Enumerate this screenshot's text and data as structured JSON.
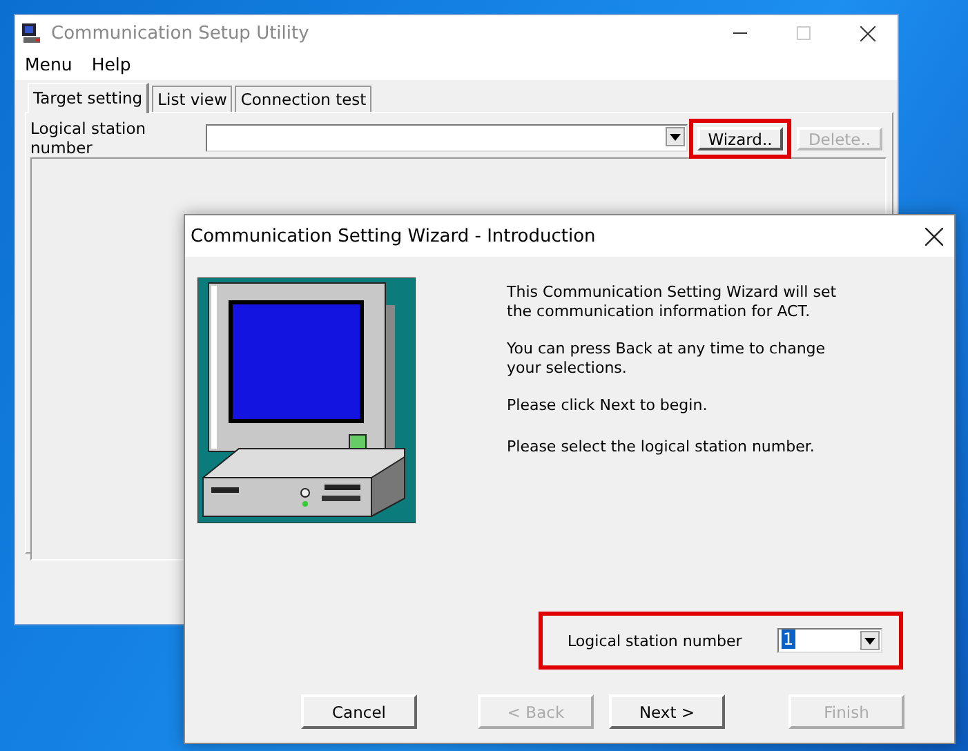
{
  "main_window": {
    "title": "Communication Setup Utility",
    "menu": [
      "Menu",
      "Help"
    ],
    "tabs": [
      {
        "label": "Target setting",
        "selected": true
      },
      {
        "label": "List view",
        "selected": false
      },
      {
        "label": "Connection test",
        "selected": false
      }
    ],
    "station_label": "Logical station number",
    "buttons": [
      {
        "label": "Wizard..",
        "disabled": false,
        "highlighted": true
      },
      {
        "label": "Delete..",
        "disabled": true,
        "highlighted": false
      }
    ]
  },
  "dialog": {
    "title": "Communication Setting Wizard - Introduction",
    "paragraphs": [
      "This Communication Setting Wizard will set the communication information for ACT.",
      "You can press Back at any time to change your selections.",
      "Please click Next to begin.",
      "Please select the logical station number."
    ],
    "station_label": "Logical station number",
    "station_value": "1",
    "station_highlighted": true,
    "buttons": [
      {
        "label": "Cancel",
        "disabled": false
      },
      {
        "label": "< Back",
        "disabled": true
      },
      {
        "label": "Next >",
        "disabled": false
      },
      {
        "label": "Finish",
        "disabled": true
      }
    ]
  }
}
